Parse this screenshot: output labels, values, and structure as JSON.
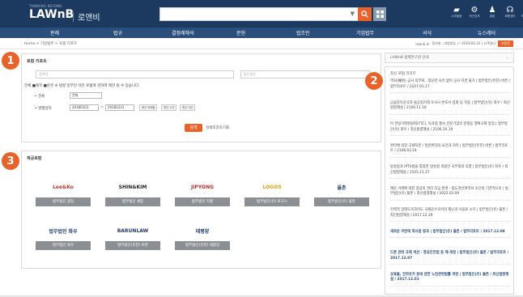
{
  "header": {
    "tag": "THINKING BEYOND",
    "logo": "LAWnB",
    "sub": "로앤비",
    "icons": [
      {
        "name": "folder-icon",
        "glyph": "▰",
        "label": "나의열람"
      },
      {
        "name": "search-settings-icon",
        "glyph": "⚙",
        "label": "최근검색"
      },
      {
        "name": "alert-icon",
        "glyph": "♟",
        "label": "알림"
      },
      {
        "name": "headset-icon",
        "glyph": "☊",
        "label": "회원센터"
      },
      {
        "name": "user-icon",
        "glyph": "♙",
        "label": "마이페이지"
      }
    ]
  },
  "nav": [
    "판례",
    "법규",
    "결정례해석",
    "문헌",
    "법조인",
    "기업법무",
    "서식",
    "뉴스레터"
  ],
  "breadcrumb": "Home > 기업법무 > 로펌 리포트",
  "crumb_right": {
    "a": "lawnb.kr",
    "b": "정보원 : 대법원등 | ~2018.06.22 | 고객센터",
    "print": "프린트"
  },
  "search_panel": {
    "title": "로펌 리포트",
    "keyword_placeholder": "검색어",
    "firm_placeholder": "법무법인",
    "options": "전체  ■제목  ■본문  ※ 법령 일부만 어떤 로펌에 관하여 제한 될 수 있습니다",
    "type_label": "• 분류",
    "type_value": "전체",
    "date_label": "• 발행일자",
    "date_from": "20160101",
    "date_to": "20181231",
    "chips": [
      "최근 6개월",
      "최근 1년",
      "최근 3년"
    ],
    "search_btn": "검색",
    "reset": "검색조건초기화"
  },
  "firms_panel": {
    "title": "제공로펌",
    "firms": [
      {
        "logo": "Lee&Ko",
        "name": "법무법인 광장",
        "color": "#c0392b"
      },
      {
        "logo": "SHIN&KIM",
        "name": "법무법인 세종",
        "color": "#222222"
      },
      {
        "logo": "JIPYONG",
        "name": "법무법인 지평",
        "color": "#b03030"
      },
      {
        "logo": "LOGOS",
        "name": "법무법인(유) 로고스",
        "color": "#d4a017"
      },
      {
        "logo": "율촌",
        "name": "법무법인(유) 율촌",
        "color": "#1f3f6a"
      },
      {
        "logo": "법무법인 화우",
        "name": "법무법인 화우",
        "color": "#1f3f6a"
      },
      {
        "logo": "BARUNLAW",
        "name": "법무법인(유한) 바른",
        "color": "#223c6b"
      },
      {
        "logo": "태평양",
        "name": "법무법인(유한) 태평양",
        "color": "#1f3f6a"
      }
    ]
  },
  "sidebar": {
    "dropdown": "LAWnB 법제연구원 안내",
    "title": "최신 로펌 리포트",
    "items": [
      {
        "text": "역사(陳列) 공사 의무화...정당한 사유 없이 공사 지연 불가 | 법무법인(유한) 바른 / 법무리포트 / 2107.01.17",
        "bold": false
      },
      {
        "text": "금융감독당국의 불공정거래 조사시 변호사 입회 등 허용 | 법무법인(유) 화우 / 최신법령해설 / 2106.11.16",
        "bold": false
      },
      {
        "text": "미 연방거래위원회(FTC), 독과점 행사 전문기업의 분쟁등 행위규제 방침 | 법무법인(유) 화우 / 최신법령해설 / 2106.10.19",
        "bold": false
      },
      {
        "text": "위탁에 의한 국세처분 / 일반위탁의 요건과 의미 | 법무법인(유한) 바른 / 법무리포트 / 2106.03.24",
        "bold": false
      },
      {
        "text": "방송법과 IPTV법을 통합한 방송법 개정안 국무회의 의결 | 법무법인(유) 화우 / 최신법령해설 / 2105.11.27",
        "bold": false
      },
      {
        "text": "해운 거래에 대한 협상의 권리 지금 변경 - 법도경산여역서 조건의 기준적으로 | 법무법인(유) 율촌 / 최신법령해설 / 2022.03.09",
        "bold": false
      },
      {
        "text": "전략적 업태도독하이도 국제운수조어의 재난과 사용료 소득 | 법무법인(유) 율촌 / 최신법령해설 / 2017.12.29",
        "bold": false
      },
      {
        "text": "새로운 미란에 회사법 동과 | 법무법인(유) 율촌 / 법무리포트 / 2017.12.08",
        "bold": true
      },
      {
        "text": "드론 관련 규제 개선 - 항공안전법 등 제·개정 | 법무법인(유) 율촌 / 법무리포트 / 2017.12.07",
        "bold": true
      },
      {
        "text": "상표들, 전자유가 등에 관한 노천관련법률 개정 | 법무법인(유) 율촌 / 최신법령해설 / 2017.12.01",
        "bold": true
      }
    ]
  },
  "badges": [
    "1",
    "2",
    "3"
  ]
}
